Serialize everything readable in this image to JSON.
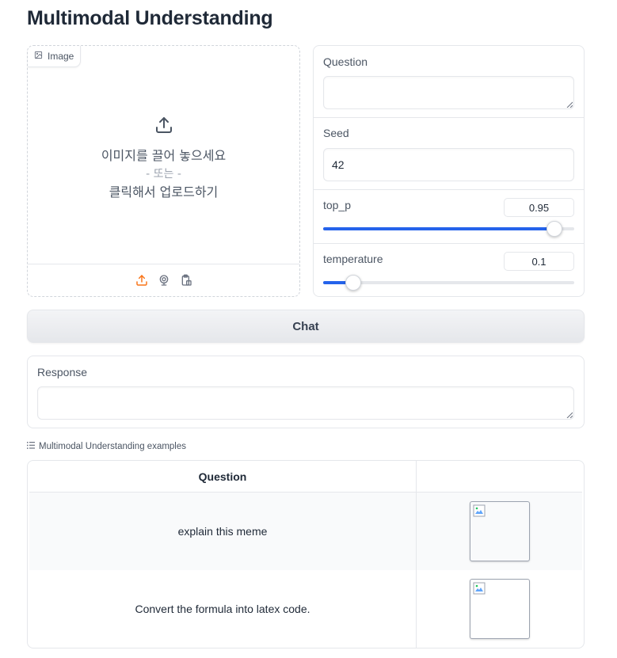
{
  "page": {
    "title": "Multimodal Understanding"
  },
  "image_upload": {
    "label": "Image",
    "drop_text": "이미지를 끌어 놓으세요",
    "or_text": "- 또는 -",
    "click_text": "클릭해서 업로드하기",
    "tools": [
      "upload-icon",
      "webcam-icon",
      "clipboard-icon"
    ],
    "accent_color": "#f97316"
  },
  "controls": {
    "question": {
      "label": "Question",
      "value": "",
      "placeholder": ""
    },
    "seed": {
      "label": "Seed",
      "value": "42"
    },
    "top_p": {
      "label": "top_p",
      "value": "0.95",
      "fraction": 0.92
    },
    "temperature": {
      "label": "temperature",
      "value": "0.1",
      "fraction": 0.12
    },
    "accent_color": "#2563eb"
  },
  "chat_button": {
    "label": "Chat"
  },
  "response": {
    "label": "Response",
    "value": ""
  },
  "examples": {
    "header": "Multimodal Understanding examples",
    "columns": [
      "Question",
      ""
    ],
    "rows": [
      {
        "question": "explain this meme"
      },
      {
        "question": "Convert the formula into latex code."
      }
    ]
  }
}
